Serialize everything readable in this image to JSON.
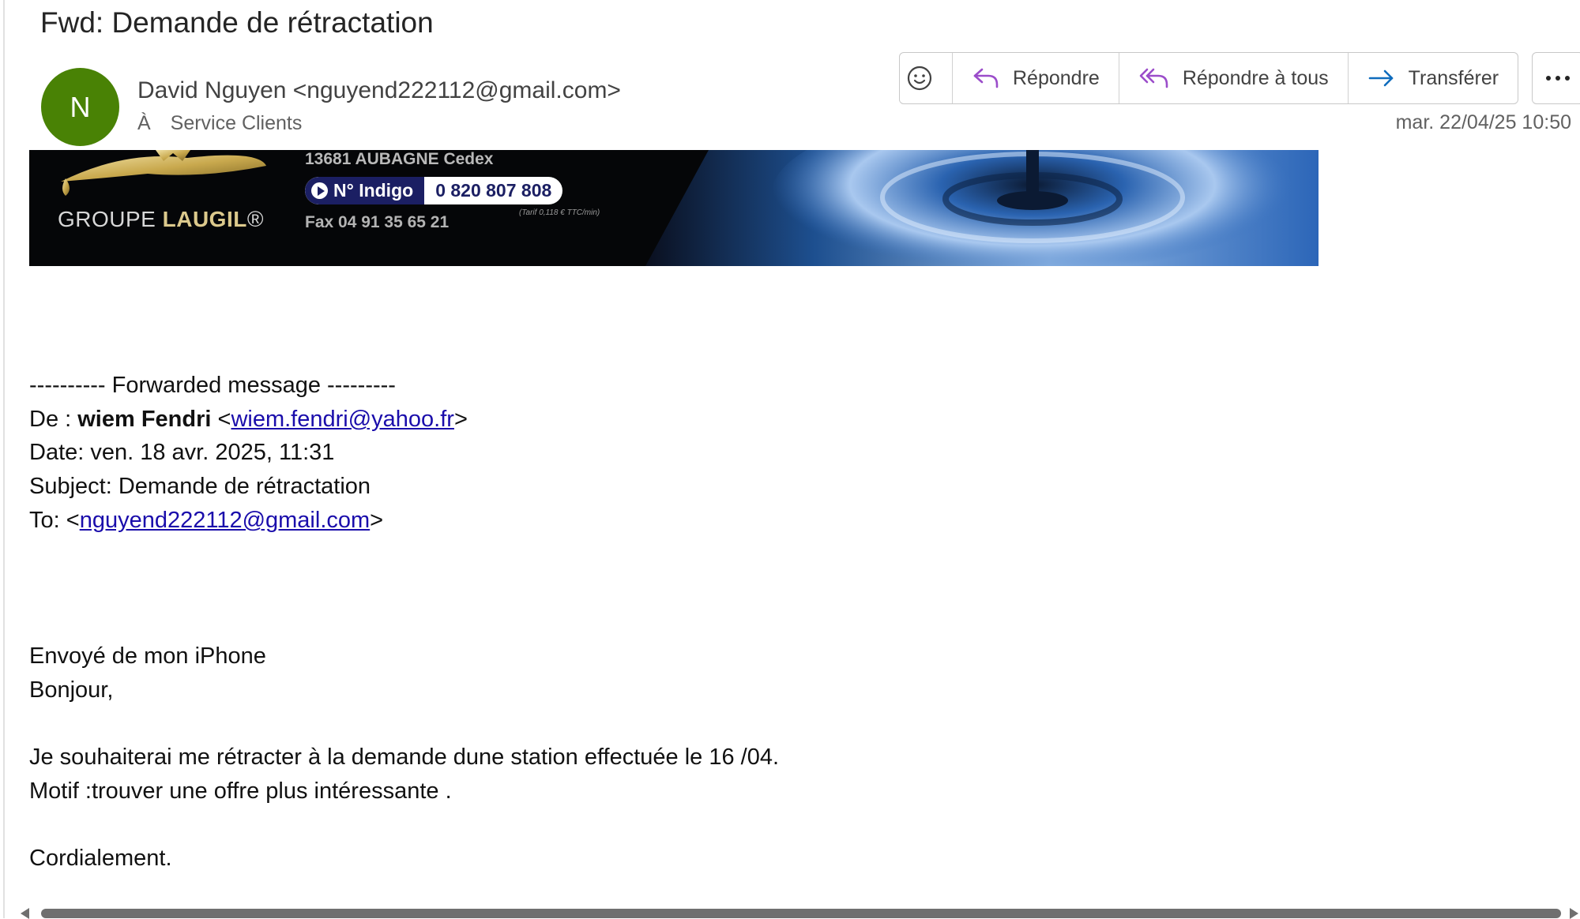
{
  "email": {
    "subject": "Fwd: Demande de rétractation",
    "avatar_initial": "N",
    "avatar_color": "#498205",
    "sender": "David Nguyen <nguyend222112@gmail.com>",
    "to_prefix": "À",
    "to": "Service Clients",
    "timestamp": "mar. 22/04/25 10:50"
  },
  "actions": {
    "emoji_icon": "smiley-icon",
    "reply": "Répondre",
    "reply_all": "Répondre à tous",
    "forward": "Transférer",
    "more_icon": "more-horizontal-icon",
    "accent_color": "#9b4dca",
    "forward_color": "#0f6cbd"
  },
  "banner": {
    "address": "13681 AUBAGNE Cedex",
    "indigo_label": "N° Indigo",
    "indigo_number": "0 820 807 808",
    "tarif": "(Tarif 0,118 € TTC/min)",
    "fax": "Fax 04 91 35 65 21",
    "brand_prefix": "GROUPE ",
    "brand_strong": "LAUGIL",
    "brand_mark": "®"
  },
  "forwarded": {
    "separator": "---------- Forwarded message ---------",
    "from_label": "De : ",
    "from_name": "wiem Fendri",
    "from_email": "wiem.fendri@yahoo.fr",
    "date_line": "Date: ven. 18 avr. 2025, 11:31",
    "subject_line": "Subject: Demande de rétractation",
    "to_label": "To: ",
    "to_email": "nguyend222112@gmail.com"
  },
  "message": {
    "signature": "Envoyé de mon iPhone",
    "greeting": "Bonjour,",
    "line1": "Je souhaiterai me rétracter à la demande dune station effectuée le 16 /04.",
    "line2": "Motif :trouver une offre plus intéressante .",
    "closing": "Cordialement."
  }
}
